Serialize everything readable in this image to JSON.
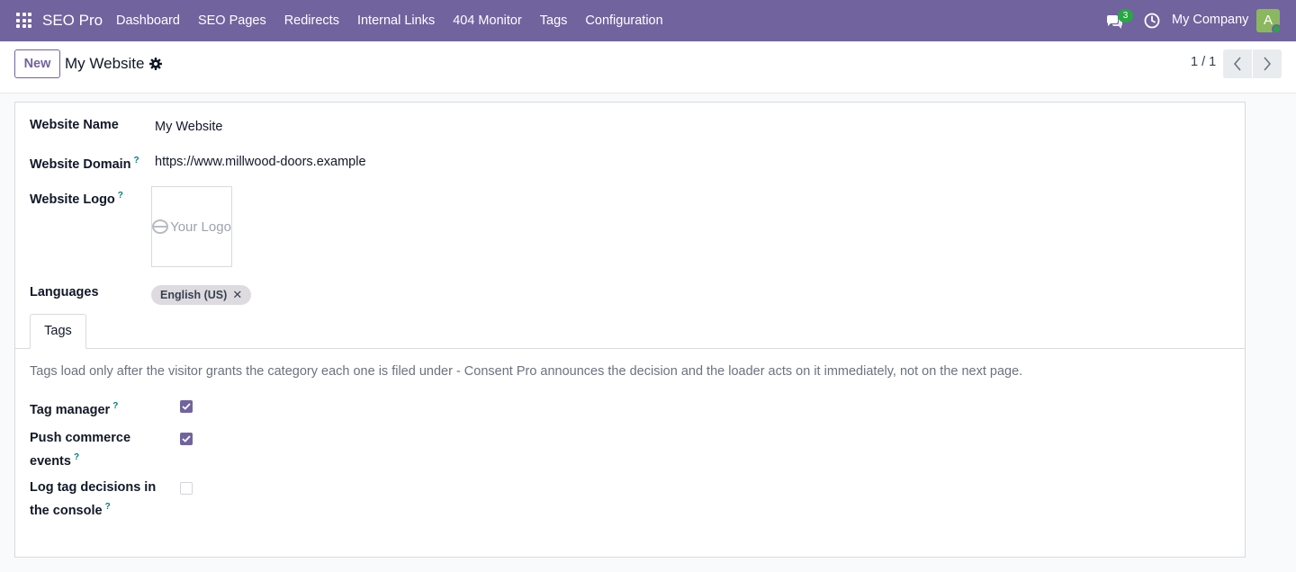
{
  "navbar": {
    "brand": "SEO Pro",
    "menu": [
      "Dashboard",
      "SEO Pages",
      "Redirects",
      "Internal Links",
      "404 Monitor",
      "Tags",
      "Configuration"
    ],
    "chat_count": "3",
    "company": "My Company",
    "avatar_initial": "A"
  },
  "control": {
    "new_label": "New",
    "record_title": "My Website",
    "pager": "1 / 1"
  },
  "form": {
    "website_name_label": "Website Name",
    "website_name_value": "My Website",
    "website_domain_label": "Website Domain",
    "website_domain_value": "https://www.millwood-doors.example",
    "website_logo_label": "Website Logo",
    "logo_text": "Your Logo",
    "languages_label": "Languages",
    "language_tag": "English (US)",
    "help_mark": "?"
  },
  "tabs": {
    "active": "Tags"
  },
  "tags_tab": {
    "description": "Tags load only after the visitor grants the category each one is filed under - Consent Pro announces the decision and the loader acts on it immediately, not on the next page.",
    "fields": [
      {
        "label_line1": "Tag manager",
        "label_line2": "",
        "checked": true
      },
      {
        "label_line1": "Push commerce",
        "label_line2": "events",
        "checked": true
      },
      {
        "label_line1": "Log tag decisions in",
        "label_line2": "the console",
        "checked": false
      }
    ]
  },
  "colors": {
    "brand": "#71639e",
    "badge": "#28a745",
    "help": "#017e84"
  }
}
